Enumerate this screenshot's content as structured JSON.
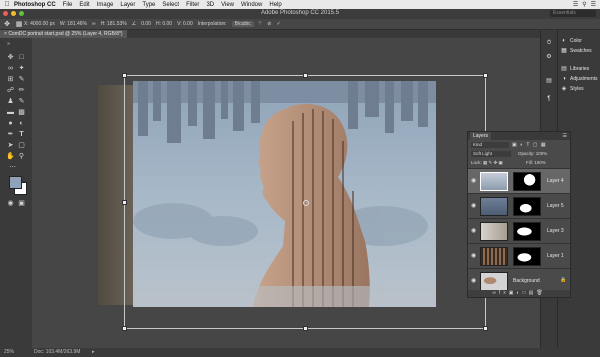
{
  "menubar": {
    "app_name": "Photoshop CC",
    "items": [
      "File",
      "Edit",
      "Image",
      "Layer",
      "Type",
      "Select",
      "Filter",
      "3D",
      "View",
      "Window",
      "Help"
    ]
  },
  "window": {
    "title": "Adobe Photoshop CC 2015.5",
    "search_placeholder": "Essentials"
  },
  "options": {
    "x": "X: 4000.00 px",
    "w": "W: 181.46%",
    "h": "H: 181.53%",
    "angle": "0.00",
    "hskew": "H: 0.00",
    "vskew": "V: 0.00",
    "interpolation_label": "Interpolation:",
    "interpolation_value": "Bicubic"
  },
  "document": {
    "tab_label": "ComDC portrait start.psd @ 25% (Layer 4, RGB/8*)",
    "status_zoom": "25%",
    "status_doc": "Doc: 103.4M/263.9M"
  },
  "dock": {
    "items": [
      {
        "label": "Color",
        "icon": "color-wheel-icon"
      },
      {
        "label": "Swatches",
        "icon": "swatches-grid-icon"
      },
      {
        "label": "Libraries",
        "icon": "libraries-icon"
      },
      {
        "label": "Adjustments",
        "icon": "adjustments-icon"
      },
      {
        "label": "Styles",
        "icon": "styles-icon"
      }
    ]
  },
  "layers": {
    "panel_title": "Layers",
    "kind_label": "Kind",
    "blend_mode": "Soft Light",
    "opacity_label": "Opacity:",
    "opacity": "100%",
    "lock_label": "Lock:",
    "fill_label": "Fill:",
    "fill": "100%",
    "rows": [
      {
        "name": "Layer 4"
      },
      {
        "name": "Layer 5"
      },
      {
        "name": "Layer 3"
      },
      {
        "name": "Layer 1"
      },
      {
        "name": "Background"
      }
    ]
  }
}
